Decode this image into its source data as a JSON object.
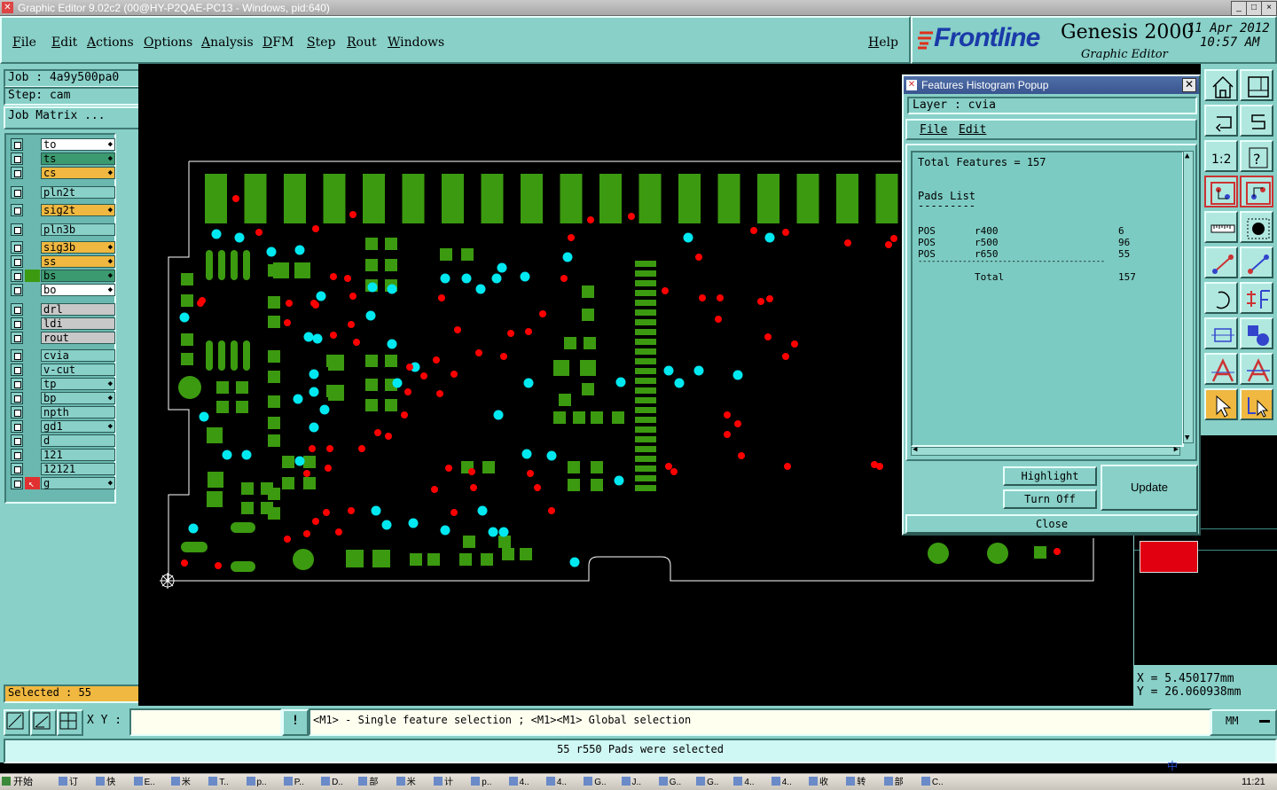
{
  "window": {
    "title": "Graphic Editor 9.02c2 (00@HY-P2QAE-PC13 - Windows, pid:640)",
    "controls": [
      "_",
      "□",
      "×"
    ]
  },
  "menu": {
    "file": "File",
    "edit": "Edit",
    "actions": "Actions",
    "options": "Options",
    "analysis": "Analysis",
    "dfm": "DFM",
    "step": "Step",
    "rout": "Rout",
    "windows": "Windows",
    "help": "Help"
  },
  "brand": {
    "logo": "Frontline",
    "product": "Genesis 2000",
    "subtitle": "Graphic Editor",
    "date": "11 Apr 2012",
    "time": "10:57 AM"
  },
  "job": {
    "job": "Job : 4a9y500pa0",
    "step": "Step: cam",
    "matrix": "Job Matrix ..."
  },
  "layers": [
    {
      "name": "to",
      "bg": "#ffffff",
      "arrow": true
    },
    {
      "name": "ts",
      "bg": "#3c9a70",
      "arrow": true
    },
    {
      "name": "cs",
      "bg": "#f0b840",
      "arrow": true
    },
    {
      "name": "pln2t",
      "bg": "#88d0c8",
      "arrow": false
    },
    {
      "name": "sig2t",
      "bg": "#f0b840",
      "arrow": true
    },
    {
      "name": "pln3b",
      "bg": "#88d0c8",
      "arrow": false
    },
    {
      "name": "sig3b",
      "bg": "#f0b840",
      "arrow": true
    },
    {
      "name": "ss",
      "bg": "#f0b840",
      "arrow": true
    },
    {
      "name": "bs",
      "bg": "#3c9a70",
      "arrow": true
    },
    {
      "name": "bo",
      "bg": "#ffffff",
      "arrow": true
    },
    {
      "name": "drl",
      "bg": "#c8c8c8",
      "arrow": false
    },
    {
      "name": "ldi",
      "bg": "#c8c8c8",
      "arrow": false
    },
    {
      "name": "rout",
      "bg": "#c8c8c8",
      "arrow": false
    },
    {
      "name": "cvia",
      "bg": "#88d0c8",
      "arrow": false
    },
    {
      "name": "v-cut",
      "bg": "#88d0c8",
      "arrow": false
    },
    {
      "name": "tp",
      "bg": "#88d0c8",
      "arrow": true
    },
    {
      "name": "bp",
      "bg": "#88d0c8",
      "arrow": true
    },
    {
      "name": "npth",
      "bg": "#88d0c8",
      "arrow": false
    },
    {
      "name": "gd1",
      "bg": "#88d0c8",
      "arrow": true
    },
    {
      "name": "d",
      "bg": "#88d0c8",
      "arrow": false
    },
    {
      "name": "121",
      "bg": "#88d0c8",
      "arrow": false
    },
    {
      "name": "12121",
      "bg": "#88d0c8",
      "arrow": false
    },
    {
      "name": "g",
      "bg": "#88d0c8",
      "arrow": true
    }
  ],
  "selected": "Selected : 55",
  "popup": {
    "title": "Features Histogram Popup",
    "layer_label": "Layer :  cvia",
    "menu_file": "File",
    "menu_edit": "Edit",
    "total_line": "Total Features = 157",
    "pads_heading": "Pads List",
    "pads_underline": "---------",
    "rows": [
      {
        "type": "POS",
        "sym": "r400",
        "count": "6"
      },
      {
        "type": "POS",
        "sym": "r500",
        "count": "96"
      },
      {
        "type": "POS",
        "sym": "r650",
        "count": "55"
      }
    ],
    "separator": "------------------------------------------",
    "total_label": "Total",
    "total_value": "157",
    "btn_highlight": "Highlight",
    "btn_turnoff": "Turn Off",
    "btn_update": "Update",
    "btn_close": "Close"
  },
  "coords": {
    "x": "X  =  5.450177mm",
    "y": "Y  = 26.060938mm"
  },
  "bottom": {
    "xy_label": "X Y :",
    "xy_value": "",
    "hint": "<M1> - Single feature selection ; <M1><M1> Global selection",
    "units": "MM"
  },
  "status": "55 r550 Pads were selected",
  "taskbar": {
    "start": "开始",
    "items": [
      "订",
      "快",
      "E..",
      "米",
      "T..",
      "p..",
      "P..",
      "D..",
      "部",
      "米",
      "计",
      "p..",
      "4..",
      "4..",
      "G..",
      "J..",
      "G..",
      "G..",
      "4..",
      "4..",
      "收",
      "转",
      "部",
      "C.."
    ],
    "ime": "中",
    "clock": "11:21"
  },
  "colors": {
    "panel": "#88d0c8",
    "pad_green": "#3c9a10",
    "via_cyan": "#00e8f0",
    "via_red": "#ff0000"
  }
}
